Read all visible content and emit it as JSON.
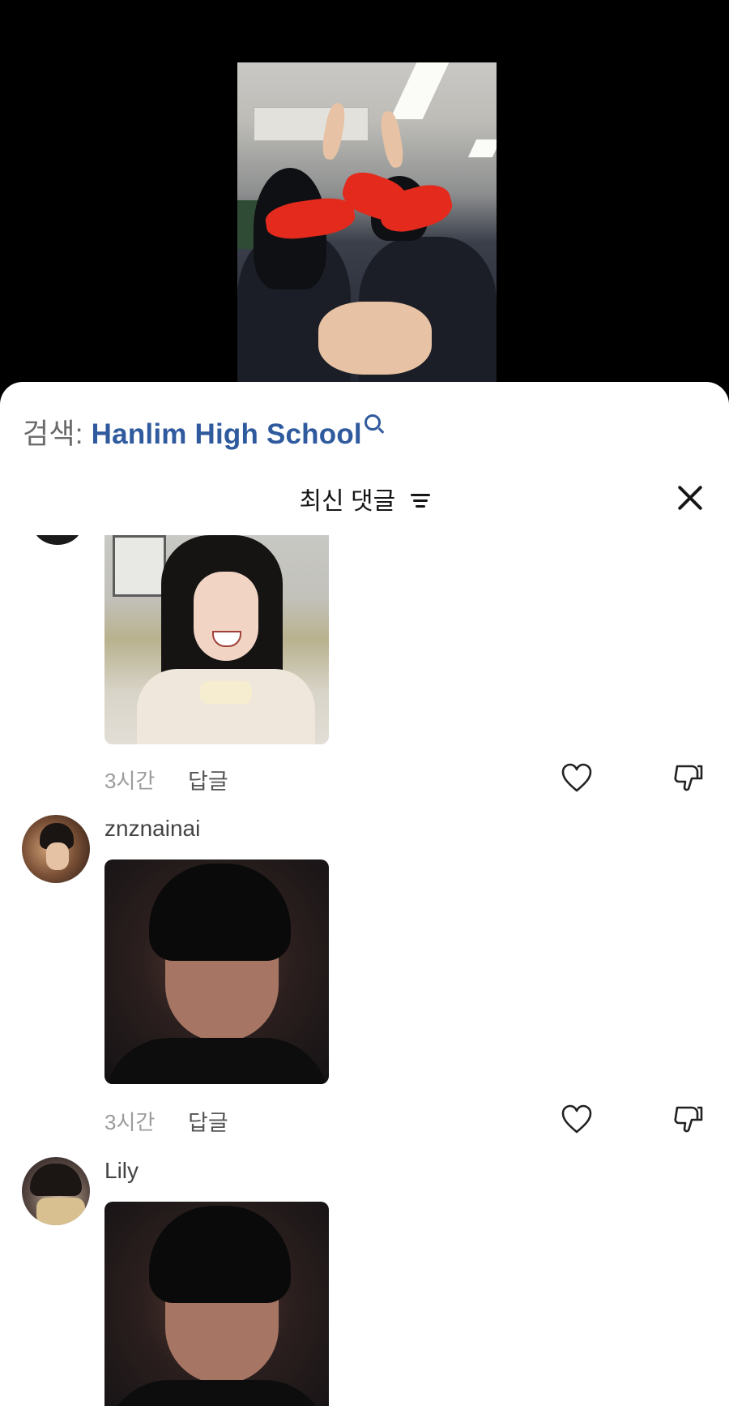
{
  "search": {
    "prefix": "검색:",
    "term": "Hanlim High School",
    "icon": "search-icon"
  },
  "header": {
    "title": "최신 댓글",
    "filter_icon": "filter-icon",
    "close_icon": "close-icon"
  },
  "comments": [
    {
      "image": "girl-laughing-photo",
      "time": "3시간",
      "reply_label": "답글"
    },
    {
      "username": "znznainai",
      "avatar": "avatar-znznainai",
      "image": "crying-man-photo",
      "time": "3시간",
      "reply_label": "답글"
    },
    {
      "username": "Lily",
      "avatar": "avatar-lily",
      "image": "crying-man-photo"
    }
  ],
  "colors": {
    "link": "#2f5a9e",
    "muted": "#9c9c9c",
    "text": "#161616",
    "sheet": "#ffffff",
    "video_bg": "#000000"
  }
}
